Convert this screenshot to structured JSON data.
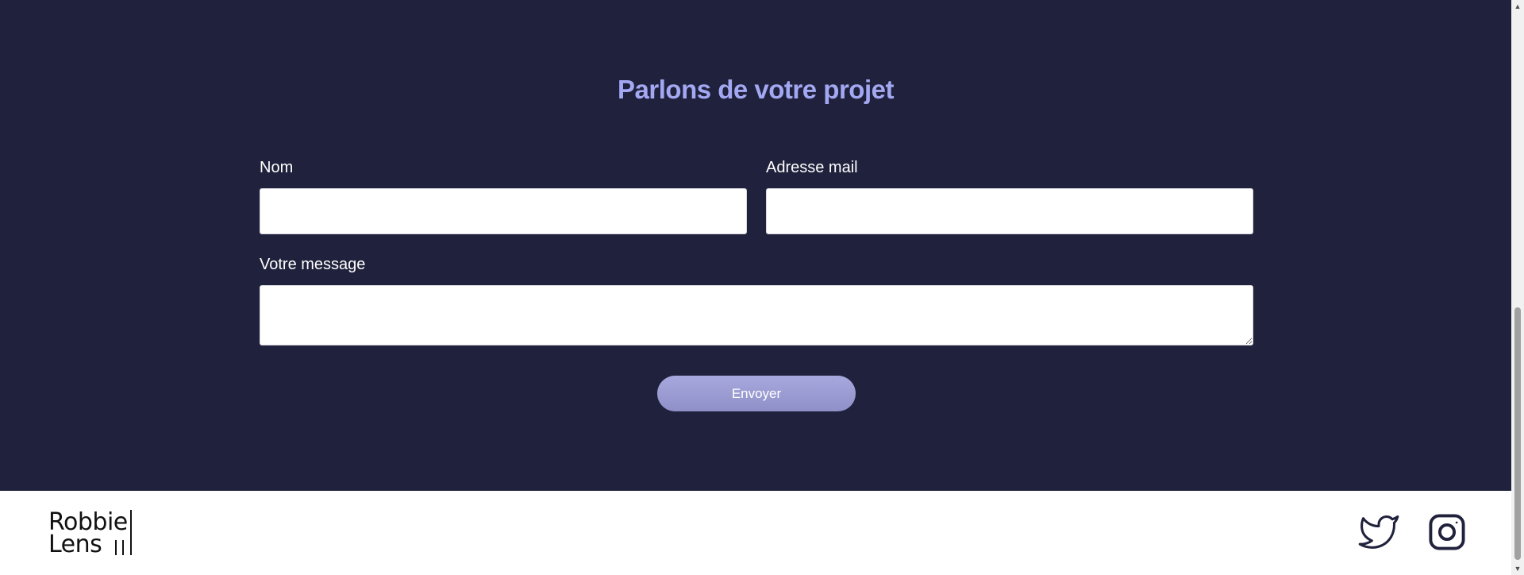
{
  "contact": {
    "title": "Parlons de votre projet",
    "name_label": "Nom",
    "name_value": "",
    "email_label": "Adresse mail",
    "email_value": "",
    "message_label": "Votre message",
    "message_value": "",
    "submit_label": "Envoyer",
    "colors": {
      "background": "#20213c",
      "title": "#a3a8f2",
      "button": "#9d9ed4"
    }
  },
  "footer": {
    "logo_line1": "Robbie",
    "logo_line2": "Lens",
    "social_icons": [
      "twitter-icon",
      "instagram-icon"
    ]
  }
}
